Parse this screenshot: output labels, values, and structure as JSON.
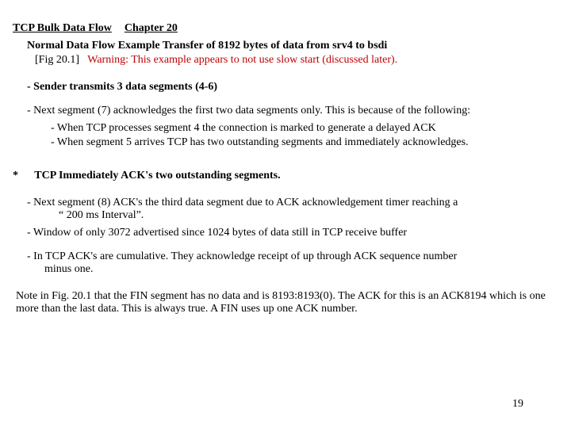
{
  "title": {
    "main": "TCP Bulk Data Flow",
    "chapter": "Chapter 20"
  },
  "subtitle": "Normal Data Flow Example Transfer of 8192 bytes of data from srv4 to bsdi",
  "fig_ref": "[Fig 20.1]",
  "warning": "Warning: This example appears to not use slow start (discussed later).",
  "sec1": "-  Sender transmits 3 data segments (4-6)",
  "seg7_line": "-  Next segment (7) acknowledges the first two data segments only. This is because of the following:",
  "seg7_sub1": "-  When TCP processes segment 4 the connection is marked to generate a delayed ACK",
  "seg7_sub2": "-  When TCP has two outstanding segments and immediately acknowledges.",
  "seg7_sub2_full": "-  When segment 5 arrives TCP has two outstanding segments and immediately acknowledges.",
  "star_mark": "*",
  "star_text": "TCP Immediately ACK's two outstanding segments.",
  "seg8_a": "-   Next segment (8) ACK's the third data segment due to ACK acknowledgement timer reaching a",
  "seg8_b": "“ 200 ms Interval”.",
  "window_line": "-   Window of only 3072 advertised since 1024 bytes of data still in TCP receive buffer",
  "cumulative_a": "-   In TCP ACK's are cumulative. They acknowledge receipt of up through ACK sequence number",
  "cumulative_b": "minus one.",
  "footer": "Note in Fig. 20.1 that the FIN segment has no data and is 8193:8193(0). The ACK for this is an ACK8194 which is one more than the last data. This is always true. A FIN uses up one ACK number.",
  "page_number": "19"
}
